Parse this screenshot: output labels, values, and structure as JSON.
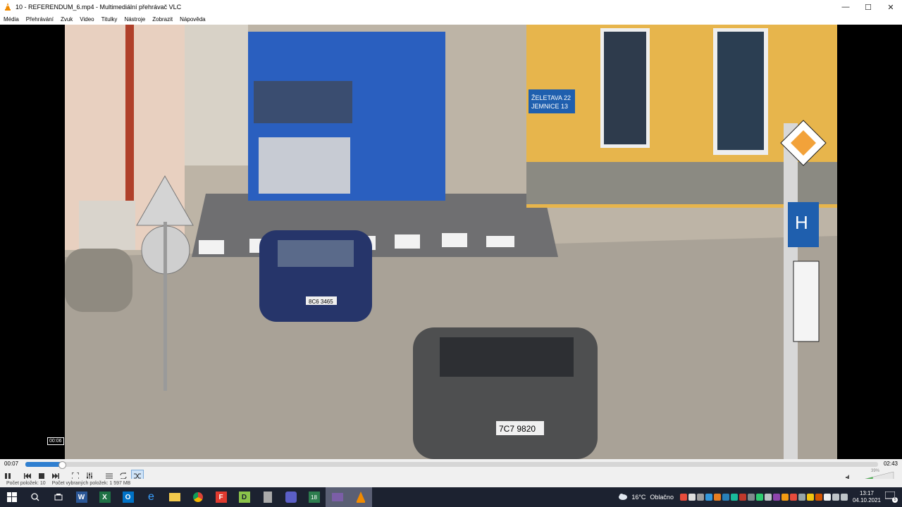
{
  "window": {
    "title": "10 - REFERENDUM_6.mp4 - Multimediální přehrávač VLC",
    "minimize": "—",
    "maximize": "☐",
    "close": "✕"
  },
  "menu": [
    "Média",
    "Přehrávání",
    "Zvuk",
    "Video",
    "Titulky",
    "Nástroje",
    "Zobrazit",
    "Nápověda"
  ],
  "video": {
    "tooltip_time": "00:06"
  },
  "playback": {
    "elapsed": "00:07",
    "total": "02:43",
    "progress": 0.043,
    "volume_label": "39%"
  },
  "status": {
    "left": "Počet položek: 10",
    "right": "Počet vybraných položek: 1  597 MB"
  },
  "taskbar": {
    "weather_temp": "16°C",
    "weather_text": "Oblačno",
    "time": "13:17",
    "date": "04.10.2021",
    "notifications": "5"
  },
  "colors": {
    "accent": "#2f7fd0",
    "taskbar": "#1c2230",
    "vlc_orange": "#f08a00"
  }
}
